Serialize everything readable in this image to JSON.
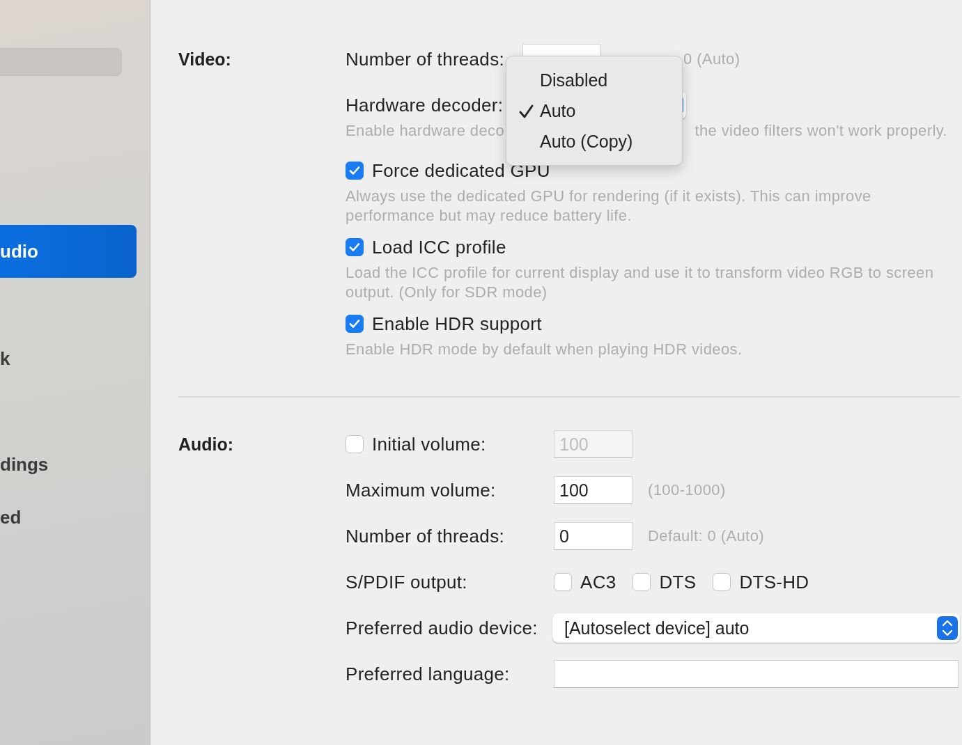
{
  "sidebar": {
    "items": [
      {
        "label": "udio",
        "selected": true
      },
      {
        "label": "k",
        "selected": false
      },
      {
        "label": "dings",
        "selected": false
      },
      {
        "label": "ed",
        "selected": false
      }
    ]
  },
  "video": {
    "label": "Video:",
    "threads": {
      "label": "Number of threads:",
      "hint": "0 (Auto)"
    },
    "decoder": {
      "label": "Hardware decoder:",
      "hint_left": "Enable hardware deco",
      "hint_right": "the video filters won't work properly.",
      "menu": [
        {
          "label": "Disabled",
          "selected": false
        },
        {
          "label": "Auto",
          "selected": true
        },
        {
          "label": "Auto (Copy)",
          "selected": false
        }
      ]
    },
    "options": [
      {
        "label": "Force dedicated GPU",
        "checked": true,
        "description": "Always use the dedicated GPU for rendering (if it exists). This can improve performance but may reduce battery life."
      },
      {
        "label": "Load ICC profile",
        "checked": true,
        "description": "Load the ICC profile for current display and use it to transform video RGB to screen output. (Only for SDR mode)"
      },
      {
        "label": "Enable HDR support",
        "checked": true,
        "description": "Enable HDR mode by default when playing HDR videos."
      }
    ]
  },
  "audio": {
    "label": "Audio:",
    "initial_volume": {
      "label": "Initial volume:",
      "checked": false,
      "value": "100",
      "disabled": true
    },
    "maximum_volume": {
      "label": "Maximum volume:",
      "value": "100",
      "hint": "(100-1000)"
    },
    "threads": {
      "label": "Number of threads:",
      "value": "0",
      "hint": "Default: 0 (Auto)"
    },
    "spdif": {
      "label": "S/PDIF output:",
      "options": [
        {
          "label": "AC3",
          "checked": false
        },
        {
          "label": "DTS",
          "checked": false
        },
        {
          "label": "DTS-HD",
          "checked": false
        }
      ]
    },
    "device": {
      "label": "Preferred audio device:",
      "value": "[Autoselect device] auto"
    },
    "language": {
      "label": "Preferred language:"
    }
  }
}
